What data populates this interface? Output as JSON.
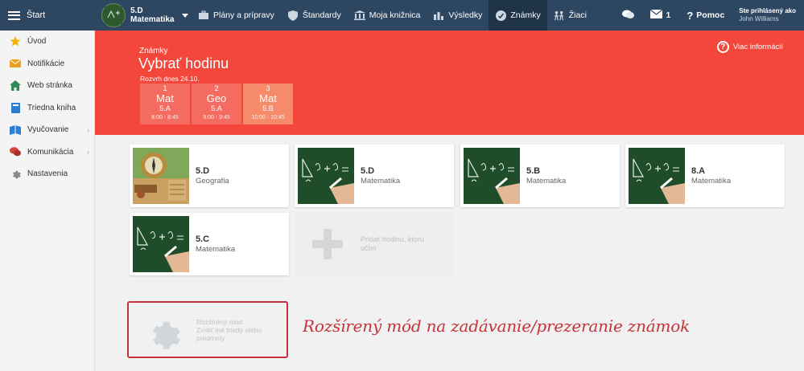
{
  "topbar": {
    "start_label": "Štart",
    "class_name": "5.D",
    "class_subject": "Matematika",
    "nav": [
      {
        "label": "Plány a prípravy",
        "icon": "briefcase-icon"
      },
      {
        "label": "Štandardy",
        "icon": "shield-icon"
      },
      {
        "label": "Moja knižnica",
        "icon": "library-icon"
      },
      {
        "label": "Výsledky",
        "icon": "bar-chart-icon"
      },
      {
        "label": "Známky",
        "icon": "grades-icon",
        "active": true
      },
      {
        "label": "Žiaci",
        "icon": "students-icon"
      }
    ],
    "messages_count": "1",
    "help_label": "Pomoc",
    "logged_in_label": "Ste prihlásený ako",
    "user_name": "John Williams"
  },
  "sidebar": {
    "items": [
      {
        "label": "Úvod",
        "icon": "star-icon",
        "color": "#f0b400"
      },
      {
        "label": "Notifikácie",
        "icon": "envelope-icon",
        "color": "#e8a020"
      },
      {
        "label": "Web stránka",
        "icon": "home-icon",
        "color": "#2e8b57"
      },
      {
        "label": "Triedna kniha",
        "icon": "book-icon",
        "color": "#2a7fd4"
      },
      {
        "label": "Vyučovanie",
        "icon": "teaching-icon",
        "color": "#2a7fd4",
        "arrow": true
      },
      {
        "label": "Komunikácia",
        "icon": "chat-icon",
        "color": "#d0483a",
        "arrow": true
      },
      {
        "label": "Nastavenia",
        "icon": "gear-icon",
        "color": "#888888"
      }
    ]
  },
  "hero": {
    "section": "Známky",
    "title": "Vybrať hodinu",
    "today": "Rozvrh dnes 24.10.",
    "info": "Viac informácií",
    "lessons": [
      {
        "num": "1",
        "subject": "Mat",
        "class": "5.A",
        "time": "8:00 - 8:45"
      },
      {
        "num": "2",
        "subject": "Geo",
        "class": "5.A",
        "time": "9:00 - 9:45"
      },
      {
        "num": "3",
        "subject": "Mat",
        "class": "5.B",
        "time": "10:00 - 10:45"
      }
    ]
  },
  "cards": [
    {
      "title": "5.D",
      "subject": "Geografia",
      "image": "compass"
    },
    {
      "title": "5.D",
      "subject": "Matematika",
      "image": "chalkboard"
    },
    {
      "title": "5.B",
      "subject": "Matematika",
      "image": "chalkboard"
    },
    {
      "title": "8.A",
      "subject": "Matematika",
      "image": "chalkboard"
    },
    {
      "title": "5.C",
      "subject": "Matematika",
      "image": "chalkboard"
    }
  ],
  "add_card": {
    "label": "Pridať hodinu, ktorú učím"
  },
  "advanced": {
    "title": "Rozšírený mód",
    "subtitle": "Zvoliť iné triedy alebo predmety"
  },
  "annotation": "Rozšírený mód na zadávanie/prezeranie známok",
  "colors": {
    "topbar": "#2d4762",
    "hero": "#f2473a",
    "annotation": "#c6323a"
  }
}
